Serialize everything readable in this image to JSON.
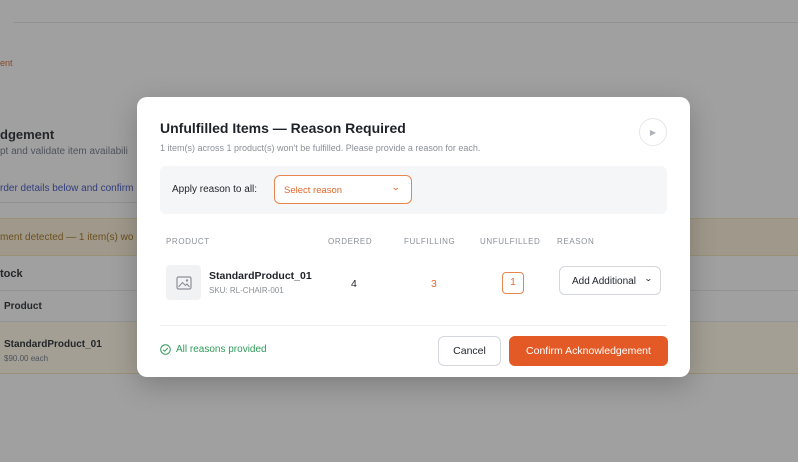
{
  "background": {
    "breadcrumb_fragment": "ent",
    "title_fragment": "dgement",
    "subtitle_fragment": "pt and validate item availabili",
    "info_fragment": "rder details below and confirm",
    "warning_fragment": "ment detected — 1 item(s) wo",
    "section_fragment": "tock",
    "table_header": "Product",
    "row_name": "StandardProduct_01",
    "row_price": "$90.00 each"
  },
  "modal": {
    "title": "Unfulfilled Items — Reason Required",
    "subtitle": "1 item(s) across 1 product(s) won't be fulfilled. Please provide a reason for each.",
    "close_icon": "arrow-right-icon",
    "apply_all": {
      "label": "Apply reason to all:",
      "placeholder": "Select reason"
    },
    "table": {
      "headers": {
        "product": "PRODUCT",
        "ordered": "ORDERED",
        "fulfilling": "FULFILLING",
        "unfulfilled": "UNFULFILLED",
        "reason": "REASON"
      },
      "rows": [
        {
          "name": "StandardProduct_01",
          "sku": "SKU: RL-CHAIR-001",
          "ordered": "4",
          "fulfilling": "3",
          "unfulfilled": "1",
          "reason": "Add Additional"
        }
      ]
    },
    "status": "All reasons provided",
    "cancel_label": "Cancel",
    "confirm_label": "Confirm Acknowledgement"
  },
  "colors": {
    "accent": "#e35a26",
    "success": "#2f9b5a",
    "warning_bg": "#f6ebd2"
  }
}
